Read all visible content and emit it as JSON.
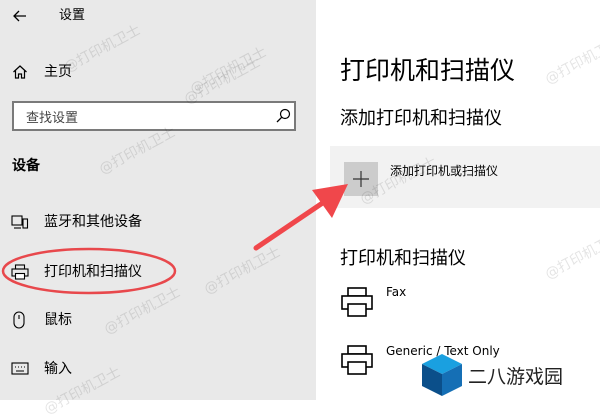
{
  "sidebar": {
    "back_icon": "back-arrow-icon",
    "title": "设置",
    "home": {
      "icon": "home-icon",
      "label": "主页"
    },
    "search_placeholder": "查找设置",
    "search_icon": "search-icon",
    "section_title": "设备",
    "items": [
      {
        "icon": "bluetooth-devices-icon",
        "label": "蓝牙和其他设备"
      },
      {
        "icon": "printer-icon",
        "label": "打印机和扫描仪"
      },
      {
        "icon": "mouse-icon",
        "label": "鼠标"
      },
      {
        "icon": "keyboard-icon",
        "label": "输入"
      }
    ]
  },
  "main": {
    "title": "打印机和扫描仪",
    "add_section_title": "添加打印机和扫描仪",
    "add_button_label": "添加打印机或扫描仪",
    "list_title": "打印机和扫描仪",
    "printers": [
      {
        "name": "Fax"
      },
      {
        "name": "Generic / Text Only"
      }
    ]
  },
  "annotations": {
    "arrow_color": "#f0474b",
    "highlight_color": "#e8484c"
  },
  "watermarks": {
    "text": "@打印机卫士",
    "brand": "二八游戏园"
  }
}
